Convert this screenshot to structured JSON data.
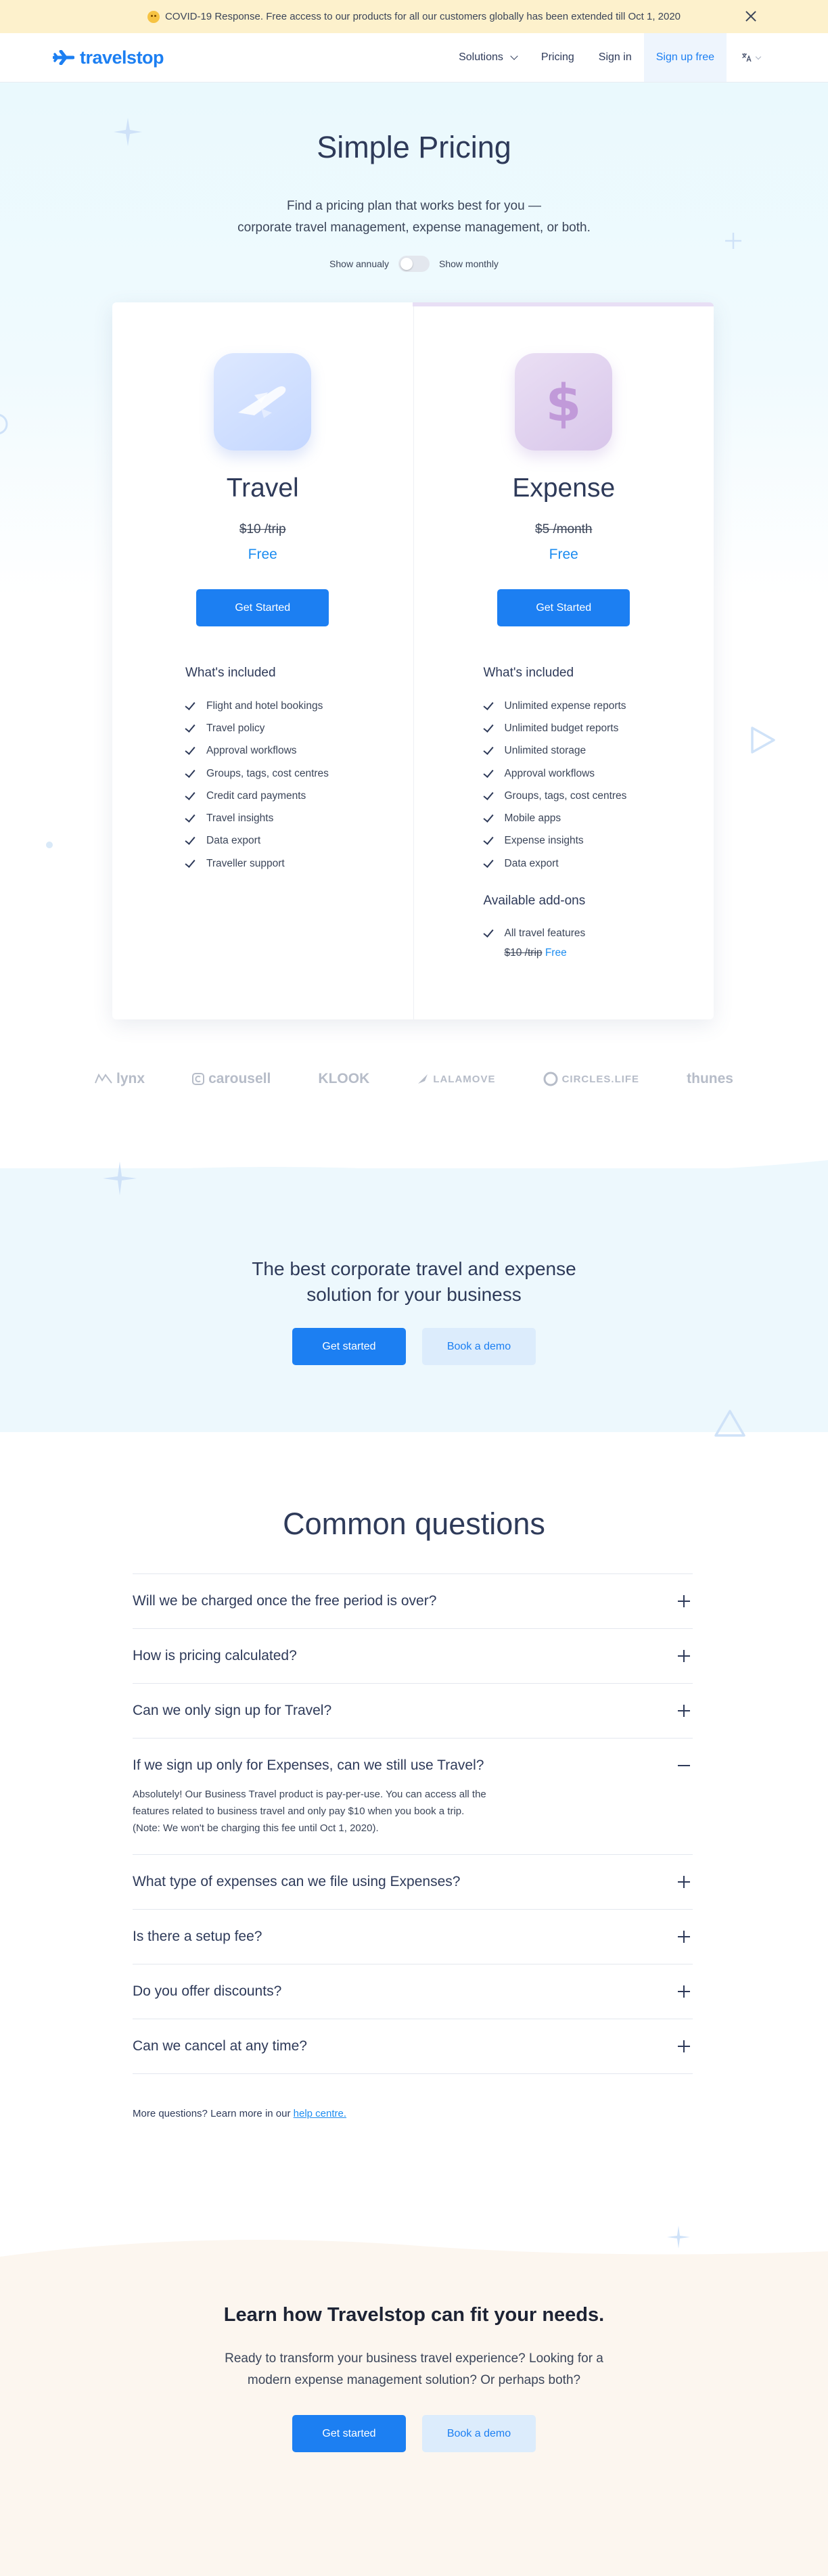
{
  "announcement": {
    "text": "COVID-19 Response. Free access to our products for all our customers globally has been extended till Oct 1, 2020",
    "emoji_icon": "smile-icon",
    "close_icon": "close-icon"
  },
  "nav": {
    "logo_text": "travelstop",
    "items": [
      {
        "label": "Solutions"
      },
      {
        "label": "Pricing"
      },
      {
        "label": "Sign in"
      },
      {
        "label": "Sign up free"
      }
    ],
    "language_icon": "translate-icon"
  },
  "hero": {
    "title": "Simple Pricing",
    "subtitle_line1": "Find a pricing plan that works best for you —",
    "subtitle_line2": "corporate travel management, expense management, or both.",
    "toggle_left": "Show annualy",
    "toggle_right": "Show monthly"
  },
  "plans": [
    {
      "name": "Travel",
      "icon": "airplane-icon",
      "old_price": "$10 /trip",
      "new_price": "Free",
      "cta": "Get Started",
      "included_title": "What's included",
      "features": [
        "Flight and hotel bookings",
        "Travel policy",
        "Approval workflows",
        "Groups, tags, cost centres",
        "Credit card payments",
        "Travel insights",
        "Data export",
        "Traveller support"
      ]
    },
    {
      "name": "Expense",
      "icon": "dollar-icon",
      "old_price": "$5 /month",
      "new_price": "Free",
      "cta": "Get Started",
      "included_title": "What's included",
      "features": [
        "Unlimited expense reports",
        "Unlimited budget reports",
        "Unlimited storage",
        "Approval workflows",
        "Groups, tags, cost centres",
        "Mobile apps",
        "Expense insights",
        "Data export"
      ],
      "addons_title": "Available add-ons",
      "addons": [
        "All travel features"
      ],
      "addon_old_price": "$10 /trip",
      "addon_new_price": "Free"
    }
  ],
  "logos": [
    "lynx",
    "carousell",
    "KLOOK",
    "LALAMOVE",
    "CIRCLES.LIFE",
    "thunes"
  ],
  "banner": {
    "title_line1": "The best corporate travel and expense",
    "title_line2": "solution for your business",
    "primary": "Get started",
    "secondary": "Book a demo"
  },
  "faq": {
    "title": "Common questions",
    "items": [
      {
        "q": "Will we be charged once the free period is over?",
        "open": false
      },
      {
        "q": "How is pricing calculated?",
        "open": false
      },
      {
        "q": "Can we only sign up for Travel?",
        "open": false
      },
      {
        "q": "If we sign up only for Expenses, can we still use Travel?",
        "open": true,
        "a_line1": "Absolutely! Our Business Travel product is pay-per-use. You can access all the",
        "a_line2": "features related to business travel and only pay $10 when you book a trip.",
        "a_line3": "(Note: We won't be charging this fee until Oct 1, 2020)."
      },
      {
        "q": "What type of expenses can we file using Expenses?",
        "open": false
      },
      {
        "q": "Is there a setup fee?",
        "open": false
      },
      {
        "q": "Do you offer discounts?",
        "open": false
      },
      {
        "q": "Can we cancel at any time?",
        "open": false
      }
    ],
    "more_prefix": "More questions? Learn more in our ",
    "more_link": "help centre."
  },
  "cta": {
    "title": "Learn how Travelstop can fit your needs.",
    "para_line1": "Ready to transform your business travel experience? Looking for a",
    "para_line2": "modern expense management solution? Or perhaps both?",
    "primary": "Get started",
    "secondary": "Book a demo"
  },
  "colors": {
    "brand_blue": "#1c7ff2",
    "announcement_bg": "#fdf1cc",
    "hero_bg": "#eaf9fd",
    "cta_bg": "#fcf6ef"
  }
}
